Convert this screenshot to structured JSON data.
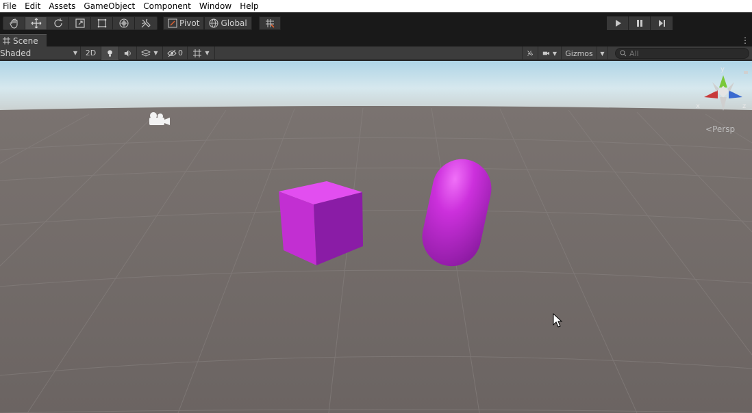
{
  "menu": [
    "File",
    "Edit",
    "Assets",
    "GameObject",
    "Component",
    "Window",
    "Help"
  ],
  "toolbar": {
    "tools": [
      "hand-tool",
      "move-tool",
      "rotate-tool",
      "scale-tool",
      "rect-tool",
      "transform-tool",
      "custom-tool"
    ],
    "active_tool": "move-tool",
    "pivot_label": "Pivot",
    "global_label": "Global"
  },
  "tab": {
    "label": "Scene"
  },
  "scenebar": {
    "draw_mode": "Shaded",
    "mode_2d": "2D",
    "hidden_count": "0",
    "gizmos_label": "Gizmos",
    "search_placeholder": "All"
  },
  "viewport": {
    "projection_label": "Persp",
    "axes": {
      "x": "x",
      "y": "y",
      "z": "z"
    }
  },
  "colors": {
    "object_magenta": "#cc33dd",
    "ground": "#6b6462",
    "sky": "#cfe6f2"
  }
}
